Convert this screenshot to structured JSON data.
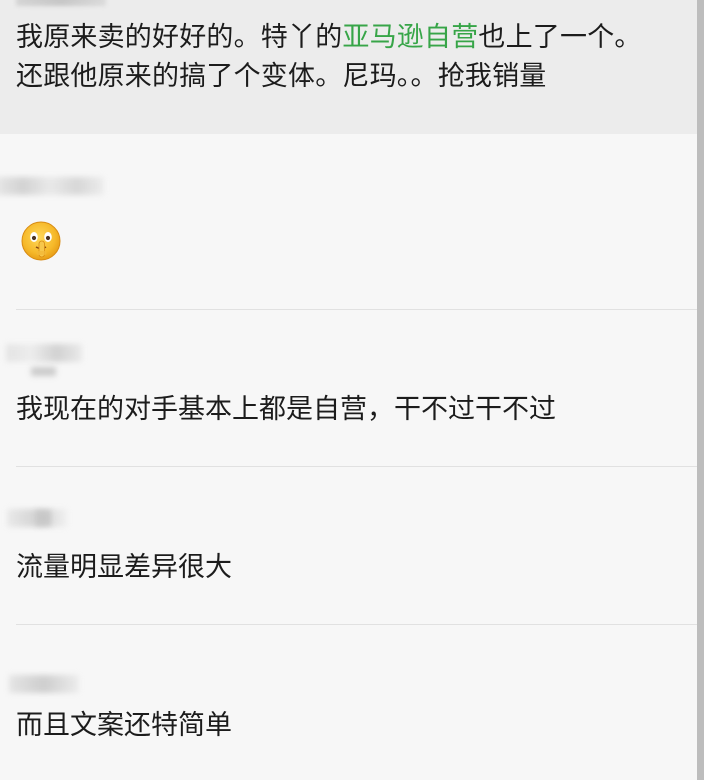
{
  "quoted": {
    "line1_before": "我原来卖的好好的。特丫的",
    "line1_highlight": "亚马逊自营",
    "line1_after": "也上了一个。",
    "line2": "还跟他原来的搞了个变体。尼玛。。抢我销量",
    "highlight_color": "#37a548"
  },
  "comments": [
    {
      "emoji": "shushing-face-with-hand-over-mouth"
    },
    {
      "text": "我现在的对手基本上都是自营，干不过干不过"
    },
    {
      "text": "流量明显差异很大"
    },
    {
      "text": "而且文案还特简单"
    }
  ]
}
